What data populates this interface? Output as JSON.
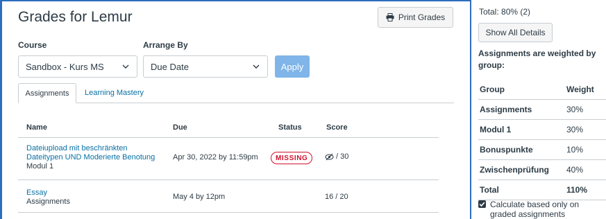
{
  "header": {
    "title": "Grades for Lemur",
    "print_label": "Print Grades"
  },
  "filters": {
    "course_label": "Course",
    "course_value": "Sandbox - Kurs MS",
    "arrange_label": "Arrange By",
    "arrange_value": "Due Date",
    "apply_label": "Apply"
  },
  "tabs": [
    {
      "label": "Assignments",
      "active": true
    },
    {
      "label": "Learning Mastery",
      "active": false
    }
  ],
  "table": {
    "headers": [
      "Name",
      "Due",
      "Status",
      "Score"
    ],
    "rows": [
      {
        "name_line1": "Dateiupload mit beschränkten",
        "name_line2": "Dateitypen UND Moderierte Benotung",
        "group": "Modul 1",
        "due": "Apr 30, 2022 by 11:59pm",
        "status": "MISSING",
        "score": "/ 30",
        "score_icon": "eye-slash-icon"
      },
      {
        "name_line1": "Essay",
        "group": "Assignments",
        "due": "May 4 by 12pm",
        "status": "",
        "score": "16 / 20"
      }
    ]
  },
  "sidebar": {
    "total": "Total: 80% (2)",
    "show_details_label": "Show All Details",
    "weight_note": "Assignments are weighted by group:",
    "weights_header": {
      "group": "Group",
      "weight": "Weight"
    },
    "weights": [
      {
        "group": "Assignments",
        "weight": "30%"
      },
      {
        "group": "Modul 1",
        "weight": "30%"
      },
      {
        "group": "Bonuspunkte",
        "weight": "10%"
      },
      {
        "group": "Zwischenprüfung",
        "weight": "40%"
      },
      {
        "group": "Total",
        "weight": "110%"
      }
    ],
    "calc_label": "Calculate based only on graded assignments",
    "calc_checked": true
  },
  "colors": {
    "accent": "#0770a3",
    "missing": "#d0112b",
    "apply_bg": "#7fb5e8",
    "frame": "#2d6dbf"
  }
}
